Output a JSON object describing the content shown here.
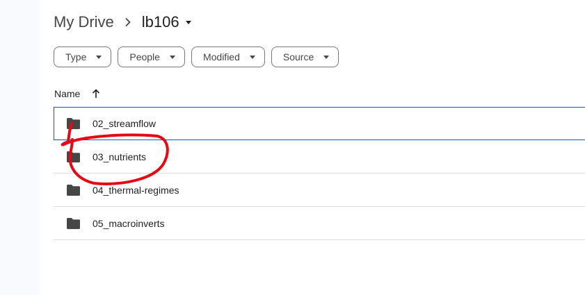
{
  "breadcrumb": {
    "root": "My Drive",
    "separator": "›",
    "current": "lb106"
  },
  "filters": [
    {
      "label": "Type"
    },
    {
      "label": "People"
    },
    {
      "label": "Modified"
    },
    {
      "label": "Source"
    }
  ],
  "list_header": {
    "name_label": "Name",
    "sort": "ascending"
  },
  "files": [
    {
      "name": "02_streamflow",
      "type": "folder",
      "focused": true
    },
    {
      "name": "03_nutrients",
      "type": "folder",
      "circled": true
    },
    {
      "name": "04_thermal-regimes",
      "type": "folder"
    },
    {
      "name": "05_macroinverts",
      "type": "folder"
    }
  ],
  "icons": {
    "folder": "folder-icon",
    "sort": "arrow-up-icon",
    "dropdown": "caret-down-icon"
  },
  "colors": {
    "focus_border": "#0b57d0",
    "annotation": "#e50914",
    "folder_icon": "#444746"
  }
}
